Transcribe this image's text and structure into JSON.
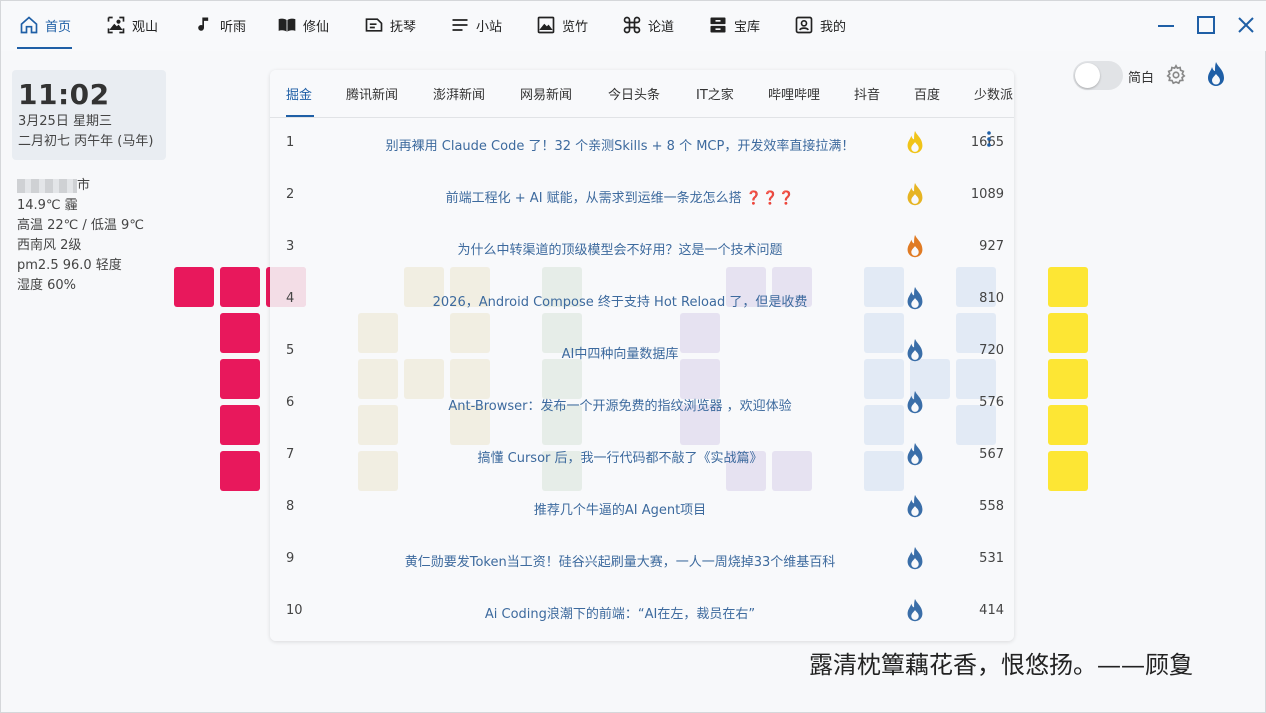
{
  "nav": {
    "items": [
      {
        "label": "首页",
        "icon": "home-icon",
        "active": true
      },
      {
        "label": "观山",
        "icon": "image-icon"
      },
      {
        "label": "听雨",
        "icon": "music-note-icon"
      },
      {
        "label": "修仙",
        "icon": "book-icon"
      },
      {
        "label": "抚琴",
        "icon": "note-card-icon"
      },
      {
        "label": "小站",
        "icon": "list-icon"
      },
      {
        "label": "览竹",
        "icon": "picture-icon"
      },
      {
        "label": "论道",
        "icon": "command-icon"
      },
      {
        "label": "宝库",
        "icon": "archive-icon"
      },
      {
        "label": "我的",
        "icon": "user-badge-icon"
      }
    ]
  },
  "clock": {
    "time": "11:02",
    "date": "3月25日   星期三",
    "lunar": "二月初七 丙午年 (马年)"
  },
  "weather": {
    "city_suffix": "市",
    "temp": "14.9℃   霾",
    "range": "高温 22℃ / 低温 9℃",
    "wind": "西南风 2级",
    "pm": "pm2.5 96.0 轻度",
    "humidity": "湿度 60%"
  },
  "tabs": [
    "掘金",
    "腾讯新闻",
    "澎湃新闻",
    "网易新闻",
    "今日头条",
    "IT之家",
    "哔哩哔哩",
    "抖音",
    "百度",
    "少数派"
  ],
  "active_tab": "掘金",
  "news": [
    {
      "rank": "1",
      "title": "别再裸用 Claude Code 了！32 个亲测Skills + 8 个 MCP，开发效率直接拉满！",
      "score": "1665",
      "flame_color": "#f0c419"
    },
    {
      "rank": "2",
      "title": "前端工程化 + AI 赋能，从需求到运维一条龙怎么搭 ❓❓❓",
      "score": "1089",
      "flame_color": "#e6b422"
    },
    {
      "rank": "3",
      "title": "为什么中转渠道的顶级模型会不好用？这是一个技术问题",
      "score": "927",
      "flame_color": "#e07b24"
    },
    {
      "rank": "4",
      "title": "2026，Android Compose 终于支持 Hot Reload 了，但是收费",
      "score": "810",
      "flame_color": "#3a6ea8"
    },
    {
      "rank": "5",
      "title": "AI中四种向量数据库",
      "score": "720",
      "flame_color": "#3a6ea8"
    },
    {
      "rank": "6",
      "title": "Ant-Browser：发布一个开源免费的指纹浏览器 ，欢迎体验",
      "score": "576",
      "flame_color": "#3a6ea8"
    },
    {
      "rank": "7",
      "title": "搞懂 Cursor 后，我一行代码都不敲了《实战篇》",
      "score": "567",
      "flame_color": "#3a6ea8"
    },
    {
      "rank": "8",
      "title": "推荐几个牛逼的AI Agent项目",
      "score": "558",
      "flame_color": "#3a6ea8"
    },
    {
      "rank": "9",
      "title": "黄仁勋要发Token当工资！硅谷兴起刷量大赛，一人一周烧掉33个维基百科",
      "score": "531",
      "flame_color": "#3a6ea8"
    },
    {
      "rank": "10",
      "title": "Ai Coding浪潮下的前端：“AI在左，裁员在右”",
      "score": "414",
      "flame_color": "#3a6ea8"
    }
  ],
  "settings": {
    "language_toggle_label": "简白",
    "language_toggle_on": false
  },
  "poem": "露清枕簟藕花香，恨悠扬。——顾夐",
  "colors": {
    "accent": "#1f5fa6",
    "tile_red": "#e8185c",
    "tile_yellow": "#fde634"
  }
}
